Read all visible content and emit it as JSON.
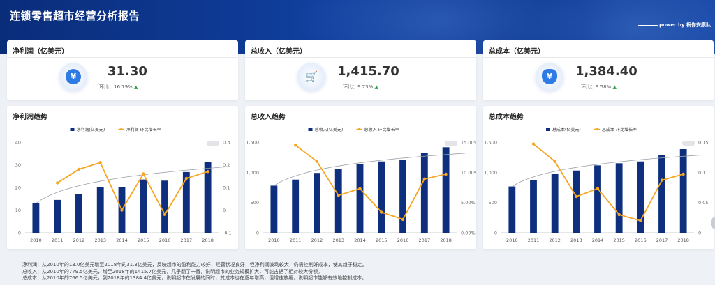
{
  "page_title": "连锁零售超市经营分析报告",
  "power_by": "power by 祝你安康队",
  "colors": {
    "bar": "#0d2f7e",
    "line": "#f5a623",
    "trend": "#9aa0a8",
    "up": "#2a9d4a"
  },
  "kpis": [
    {
      "title": "净利润（亿美元）",
      "value": "31.30",
      "ratio": "环比：16.79%",
      "icon": "yen-coin-hand-icon"
    },
    {
      "title": "总收入（亿美元）",
      "value": "1,415.70",
      "ratio": "环比：9.73%",
      "icon": "shopping-cart-icon"
    },
    {
      "title": "总成本（亿美元）",
      "value": "1,384.40",
      "ratio": "环比：9.58%",
      "icon": "money-bag-icon"
    }
  ],
  "chart_data": [
    {
      "type": "bar",
      "title": "净利润趋势",
      "categories": [
        "2010",
        "2011",
        "2012",
        "2013",
        "2014",
        "2015",
        "2016",
        "2017",
        "2018"
      ],
      "series": [
        {
          "name": "净利润(亿美元)",
          "type": "bar",
          "axis": "left",
          "values": [
            13.0,
            14.5,
            17.0,
            20.0,
            20.0,
            23.5,
            23.0,
            26.8,
            31.3
          ]
        },
        {
          "name": "净利润-环比增长率",
          "type": "line",
          "axis": "right",
          "values": [
            null,
            0.12,
            0.18,
            0.21,
            0.0,
            0.16,
            -0.02,
            0.14,
            0.17
          ]
        }
      ],
      "ylim_left": [
        0,
        40
      ],
      "yticks_left": [
        "0",
        "10",
        "20",
        "30",
        "40"
      ],
      "ylim_right": [
        -0.1,
        0.3
      ],
      "yticks_right": [
        "-0.1",
        "0",
        "0.1",
        "0.2",
        "0.3"
      ],
      "legend": "top-center",
      "trendline": true
    },
    {
      "type": "bar",
      "title": "总收入趋势",
      "categories": [
        "2010",
        "2011",
        "2012",
        "2013",
        "2014",
        "2015",
        "2016",
        "2017",
        "2018"
      ],
      "series": [
        {
          "name": "总收入(亿美元)",
          "type": "bar",
          "axis": "left",
          "values": [
            779.5,
            880,
            990,
            1050,
            1140,
            1180,
            1210,
            1320,
            1415.7
          ]
        },
        {
          "name": "总收入-环比增长率",
          "type": "line",
          "axis": "right",
          "values": [
            null,
            0.145,
            0.118,
            0.062,
            0.073,
            0.034,
            0.022,
            0.089,
            0.097
          ]
        }
      ],
      "ylim_left": [
        0,
        1500
      ],
      "yticks_left": [
        "0",
        "500",
        "1,000",
        "1,500"
      ],
      "ylim_right": [
        0,
        0.15
      ],
      "yticks_right": [
        "0.00%",
        "5.00%",
        "10.00%",
        "15.00%"
      ],
      "legend": "top-center",
      "trendline": true
    },
    {
      "type": "bar",
      "title": "总成本趋势",
      "categories": [
        "2010",
        "2011",
        "2012",
        "2013",
        "2014",
        "2015",
        "2016",
        "2017",
        "2018"
      ],
      "series": [
        {
          "name": "总成本(亿美元)",
          "type": "bar",
          "axis": "left",
          "values": [
            766.5,
            866,
            970,
            1030,
            1115,
            1150,
            1180,
            1290,
            1384.4
          ]
        },
        {
          "name": "总成本-环比增长率",
          "type": "line",
          "axis": "right",
          "values": [
            null,
            0.147,
            0.118,
            0.06,
            0.073,
            0.03,
            0.02,
            0.087,
            0.097
          ]
        }
      ],
      "ylim_left": [
        0,
        1500
      ],
      "yticks_left": [
        "0",
        "500",
        "1,000",
        "1,500"
      ],
      "ylim_right": [
        0,
        0.15
      ],
      "yticks_right": [
        "0",
        "0.05",
        "0.1",
        "0.15"
      ],
      "legend": "top-center",
      "trendline": true
    }
  ],
  "notes": [
    "净利润：从2010年的13.0亿美元增至2018年的31.3亿美元，反映超市的盈利能力较好，经营状况良好，但净利润波动较大，仍需控制好成本，使其趋于稳定。",
    "总收入：从2010年的779.5亿美元，增至2018年的1415.7亿美元，几乎翻了一番，说明超市的业务规模扩大，可能占据了相对较大份额。",
    "总成本：从2010年的766.5亿美元，到2018年的1384.4亿美元，说明超市在发展的同时，其成本也在逐年增高，但增速放缓，说明超市能够有效地控制成本。"
  ]
}
